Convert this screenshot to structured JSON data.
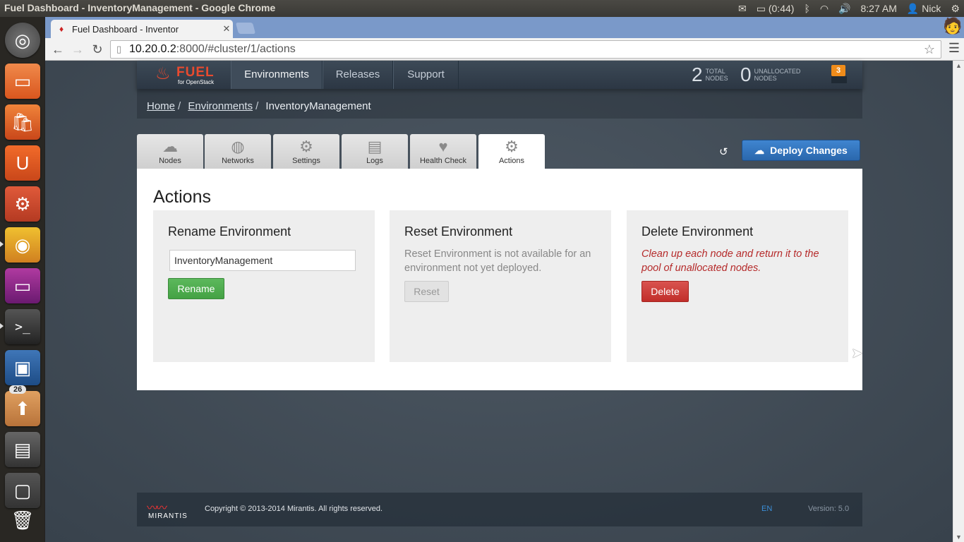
{
  "window": {
    "title": "Fuel Dashboard - InventoryManagement - Google Chrome"
  },
  "panel": {
    "battery": "(0:44)",
    "time": "8:27 AM",
    "user": "Nick"
  },
  "launcher": {
    "items": [
      {
        "name": "ubuntu-dash",
        "icon": "ubuntu-logo-icon"
      },
      {
        "name": "files",
        "icon": "folder-icon"
      },
      {
        "name": "software-center",
        "icon": "shopping-bag-icon"
      },
      {
        "name": "ubuntu-one",
        "icon": "ubuntu-one-icon"
      },
      {
        "name": "system-settings",
        "icon": "gear-wrench-icon"
      },
      {
        "name": "chrome",
        "icon": "chrome-icon"
      },
      {
        "name": "display",
        "icon": "monitor-icon"
      },
      {
        "name": "terminal",
        "icon": "terminal-icon"
      },
      {
        "name": "virtualbox",
        "icon": "virtualbox-icon"
      },
      {
        "name": "update-manager",
        "icon": "update-icon",
        "badge": "26"
      },
      {
        "name": "archive",
        "icon": "archive-icon"
      },
      {
        "name": "workspaces",
        "icon": "workspace-icon"
      },
      {
        "name": "trash",
        "icon": "trash-icon"
      }
    ]
  },
  "browser": {
    "tab_title": "Fuel Dashboard - Inventor",
    "url_host": "10.20.0.2",
    "url_rest": ":8000/#cluster/1/actions"
  },
  "app_nav": {
    "logo_name": "FUEL",
    "logo_sub": "for OpenStack",
    "items": [
      "Environments",
      "Releases",
      "Support"
    ],
    "total_nodes": "2",
    "total_label_1": "TOTAL",
    "total_label_2": "NODES",
    "unallocated_nodes": "0",
    "unallocated_label_1": "UNALLOCATED",
    "unallocated_label_2": "NODES",
    "notifications": "3"
  },
  "breadcrumb": {
    "home": "Home",
    "environments": "Environments",
    "current": "InventoryManagement"
  },
  "tabs": [
    {
      "label": "Nodes",
      "icon": "cloud-icon"
    },
    {
      "label": "Networks",
      "icon": "network-icon"
    },
    {
      "label": "Settings",
      "icon": "gear-icon"
    },
    {
      "label": "Logs",
      "icon": "clipboard-icon"
    },
    {
      "label": "Health Check",
      "icon": "heart-icon"
    },
    {
      "label": "Actions",
      "icon": "cogs-icon"
    }
  ],
  "deploy_label": "Deploy Changes",
  "page": {
    "title": "Actions",
    "rename": {
      "title": "Rename Environment",
      "value": "InventoryManagement",
      "button": "Rename"
    },
    "reset": {
      "title": "Reset Environment",
      "text": "Reset Environment is not available for an environment not yet deployed.",
      "button": "Reset"
    },
    "delete": {
      "title": "Delete Environment",
      "text": "Clean up each node and return it to the pool of unallocated nodes.",
      "button": "Delete"
    }
  },
  "footer": {
    "brand": "MIRANTIS",
    "copyright": "Copyright © 2013-2014 Mirantis. All rights reserved.",
    "lang": "EN",
    "version": "Version: 5.0"
  }
}
